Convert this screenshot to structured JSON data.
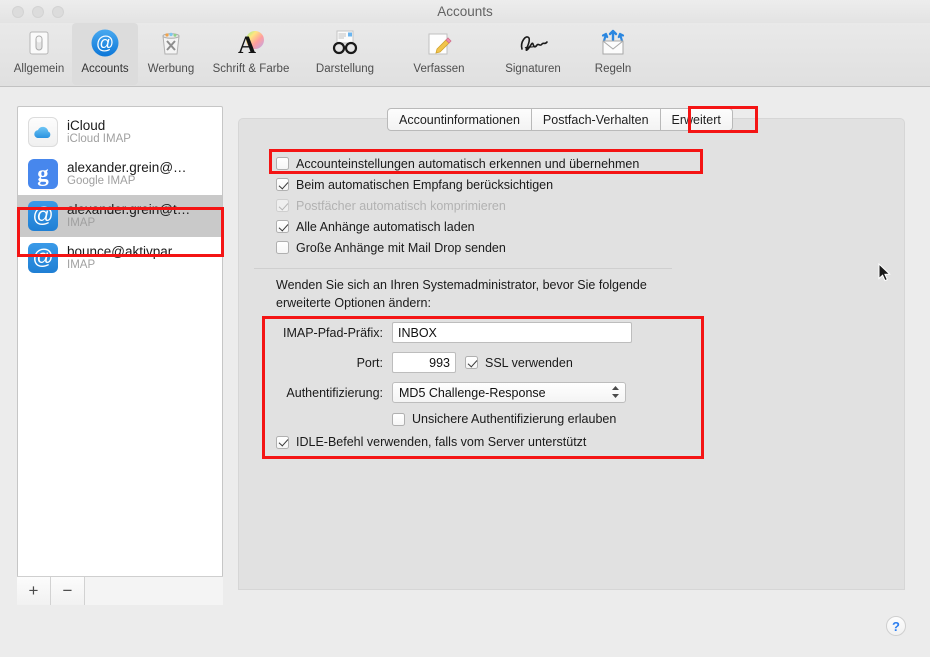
{
  "window": {
    "title": "Accounts",
    "traffic_lights": [
      "close",
      "minimize",
      "zoom"
    ]
  },
  "toolbar": {
    "items": [
      {
        "label": "Allgemein",
        "icon": "general-switch-icon",
        "selected": false
      },
      {
        "label": "Accounts",
        "icon": "at-sign-icon",
        "selected": true
      },
      {
        "label": "Werbung",
        "icon": "junk-trash-icon",
        "selected": false
      },
      {
        "label": "Schrift & Farbe",
        "icon": "font-color-icon",
        "selected": false
      },
      {
        "label": "Darstellung",
        "icon": "glasses-viewing-icon",
        "selected": false
      },
      {
        "label": "Verfassen",
        "icon": "pencil-compose-icon",
        "selected": false
      },
      {
        "label": "Signaturen",
        "icon": "signature-icon",
        "selected": false
      },
      {
        "label": "Regeln",
        "icon": "rules-envelope-icon",
        "selected": false
      }
    ]
  },
  "sidebar": {
    "accounts": [
      {
        "name": "iCloud",
        "type": "iCloud IMAP",
        "icon": "icloud-cloud-icon",
        "selected": false
      },
      {
        "name": "alexander.grein@…",
        "type": "Google IMAP",
        "icon": "google-g-icon",
        "selected": false
      },
      {
        "name": "alexander.grein@t…",
        "type": "IMAP",
        "icon": "at-sign-icon",
        "selected": true
      },
      {
        "name": "bounce@aktivpar…",
        "type": "IMAP",
        "icon": "at-sign-icon",
        "selected": false
      }
    ],
    "footer": {
      "add_label": "+",
      "remove_label": "−"
    }
  },
  "tabs": [
    {
      "label": "Accountinformationen",
      "active": false
    },
    {
      "label": "Postfach-Verhalten",
      "active": false
    },
    {
      "label": "Erweitert",
      "active": true
    }
  ],
  "main": {
    "checkboxes": [
      {
        "label": "Accounteinstellungen automatisch erkennen und übernehmen",
        "checked": false,
        "disabled": false
      },
      {
        "label": "Beim automatischen Empfang berücksichtigen",
        "checked": true,
        "disabled": false
      },
      {
        "label": "Postfächer automatisch komprimieren",
        "checked": true,
        "disabled": true
      },
      {
        "label": "Alle Anhänge automatisch laden",
        "checked": true,
        "disabled": false
      },
      {
        "label": "Große Anhänge mit Mail Drop senden",
        "checked": false,
        "disabled": false
      }
    ],
    "note": "Wenden Sie sich an Ihren Systemadministrator, bevor Sie folgende erweiterte Optionen ändern:",
    "fields": {
      "prefix_label": "IMAP-Pfad-Präfix:",
      "prefix_value": "INBOX",
      "prefix_placeholder": "",
      "port_label": "Port:",
      "port_value": "993",
      "ssl_label": "SSL verwenden",
      "ssl_checked": true,
      "auth_label": "Authentifizierung:",
      "auth_value": "MD5 Challenge-Response",
      "auth_options": [
        "MD5 Challenge-Response"
      ],
      "insecure_label": "Unsichere Authentifizierung erlauben",
      "insecure_checked": false,
      "idle_label": "IDLE-Befehl verwenden, falls vom Server unterstützt",
      "idle_checked": true
    }
  },
  "help": {
    "label": "?"
  },
  "annotations": {
    "color": "#f41414",
    "boxes": [
      "selected-account-row",
      "erweitert-tab",
      "autodetect-checkbox",
      "advanced-settings-group"
    ]
  }
}
